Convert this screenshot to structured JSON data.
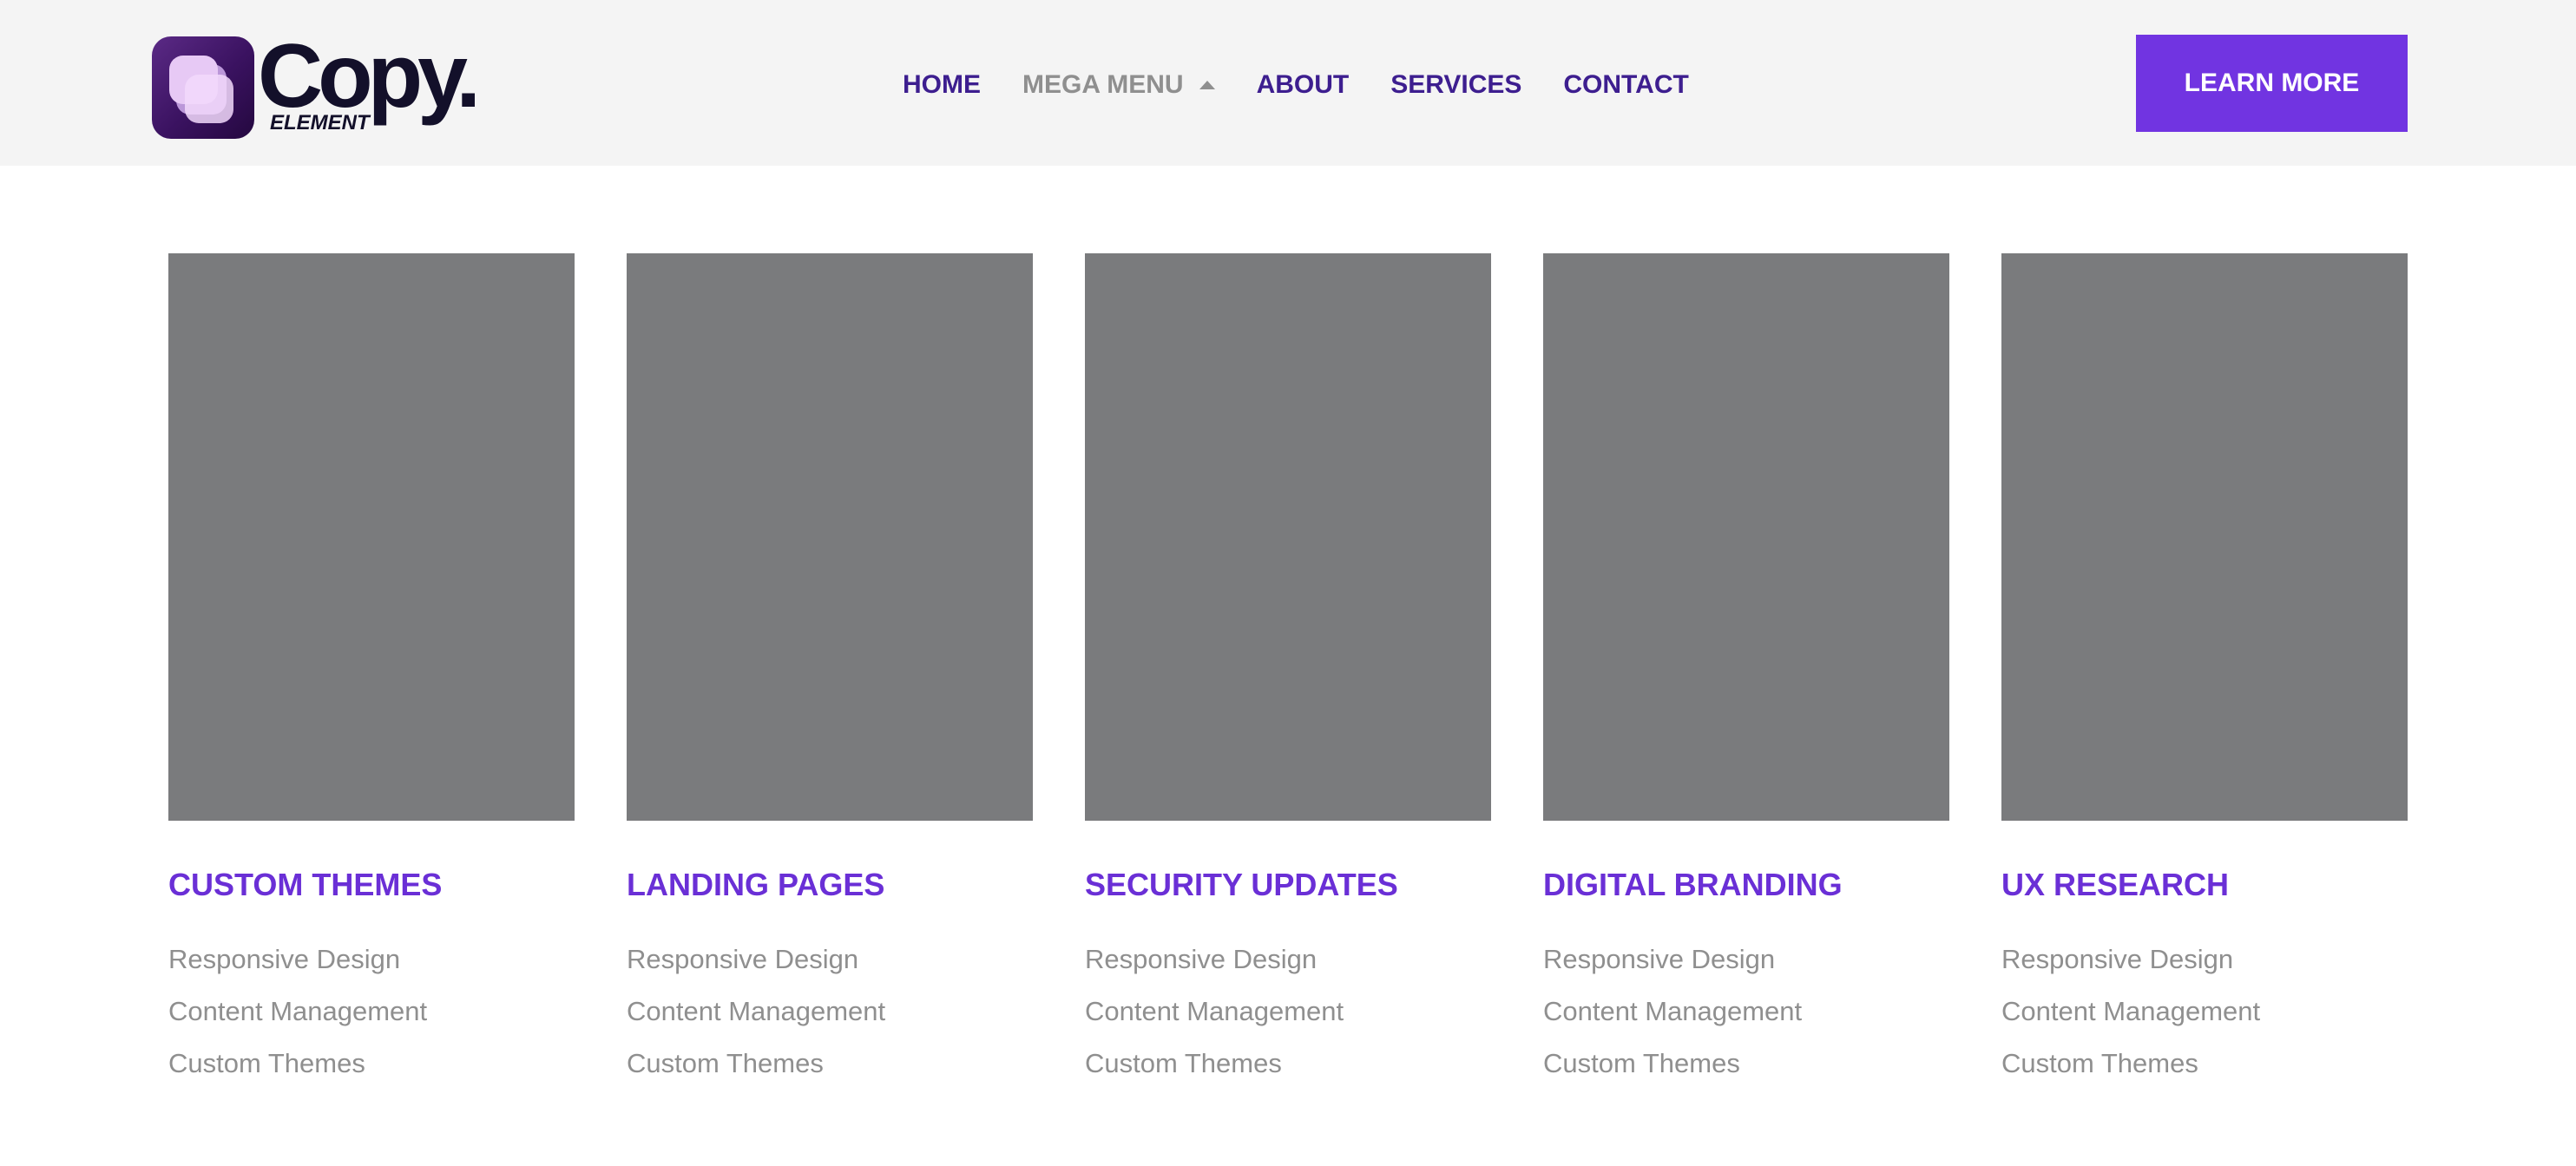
{
  "brand": {
    "name": "Copy.",
    "subtitle": "ELEMENT"
  },
  "nav": {
    "items": [
      {
        "label": "HOME"
      },
      {
        "label": "MEGA MENU"
      },
      {
        "label": "ABOUT"
      },
      {
        "label": "SERVICES"
      },
      {
        "label": "CONTACT"
      }
    ],
    "active": "MEGA MENU"
  },
  "cta": {
    "label": "LEARN MORE"
  },
  "cards": [
    {
      "title": "CUSTOM THEMES",
      "links": [
        "Responsive Design",
        "Content Management",
        "Custom Themes"
      ]
    },
    {
      "title": "LANDING PAGES",
      "links": [
        "Responsive Design",
        "Content Management",
        "Custom Themes"
      ]
    },
    {
      "title": "SECURITY UPDATES",
      "links": [
        "Responsive Design",
        "Content Management",
        "Custom Themes"
      ]
    },
    {
      "title": "DIGITAL BRANDING",
      "links": [
        "Responsive Design",
        "Content Management",
        "Custom Themes"
      ]
    },
    {
      "title": "UX RESEARCH",
      "links": [
        "Responsive Design",
        "Content Management",
        "Custom Themes"
      ]
    }
  ],
  "colors": {
    "accent": "#7134e1",
    "nav_text": "#3d1e8f",
    "card_title": "#6a2fd6",
    "muted_text": "#8f8f8f",
    "placeholder": "#7a7b7d",
    "header_bg": "#f4f4f4"
  },
  "icons": {
    "mega_menu_caret": "caret-up-icon",
    "logo": "stacked-squares-logo-icon"
  }
}
